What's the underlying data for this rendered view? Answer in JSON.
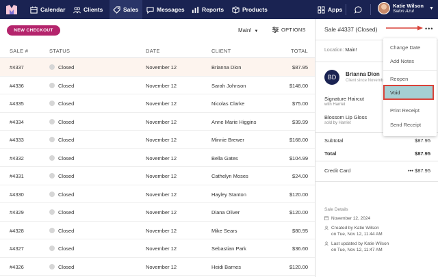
{
  "nav": {
    "items": [
      {
        "label": "Calendar",
        "icon": "calendar-icon"
      },
      {
        "label": "Clients",
        "icon": "users-icon"
      },
      {
        "label": "Sales",
        "icon": "tag-icon",
        "active": true
      },
      {
        "label": "Messages",
        "icon": "chat-icon"
      },
      {
        "label": "Reports",
        "icon": "bar-chart-icon"
      },
      {
        "label": "Products",
        "icon": "box-icon"
      }
    ],
    "apps_label": "Apps",
    "user_name": "Katie Wilson",
    "user_salon": "Salon Azul",
    "brand_color": "#1a2352",
    "accent_color": "#b4246c"
  },
  "toolbar": {
    "new_checkout_label": "NEW CHECKOUT",
    "location_select": "Main!",
    "options_label": "OPTIONS"
  },
  "table": {
    "headers": [
      "SALE #",
      "STATUS",
      "DATE",
      "CLIENT",
      "TOTAL"
    ],
    "rows": [
      {
        "sale": "#4337",
        "status": "Closed",
        "date": "November 12",
        "client": "Brianna Dion",
        "total": "$87.95"
      },
      {
        "sale": "#4336",
        "status": "Closed",
        "date": "November 12",
        "client": "Sarah Johnson",
        "total": "$148.00"
      },
      {
        "sale": "#4335",
        "status": "Closed",
        "date": "November 12",
        "client": "Nicolas Clarke",
        "total": "$75.00"
      },
      {
        "sale": "#4334",
        "status": "Closed",
        "date": "November 12",
        "client": "Anne Marie Higgins",
        "total": "$39.99"
      },
      {
        "sale": "#4333",
        "status": "Closed",
        "date": "November 12",
        "client": "Minnie Brewer",
        "total": "$168.00"
      },
      {
        "sale": "#4332",
        "status": "Closed",
        "date": "November 12",
        "client": "Bella Gates",
        "total": "$104.99"
      },
      {
        "sale": "#4331",
        "status": "Closed",
        "date": "November 12",
        "client": "Cathelyn Moses",
        "total": "$24.00"
      },
      {
        "sale": "#4330",
        "status": "Closed",
        "date": "November 12",
        "client": "Hayley Stanton",
        "total": "$120.00"
      },
      {
        "sale": "#4329",
        "status": "Closed",
        "date": "November 12",
        "client": "Diana Oliver",
        "total": "$120.00"
      },
      {
        "sale": "#4328",
        "status": "Closed",
        "date": "November 12",
        "client": "Mike Sears",
        "total": "$80.95"
      },
      {
        "sale": "#4327",
        "status": "Closed",
        "date": "November 12",
        "client": "Sebastian Park",
        "total": "$36.60"
      },
      {
        "sale": "#4326",
        "status": "Closed",
        "date": "November 12",
        "client": "Heidi Barnes",
        "total": "$120.00"
      }
    ]
  },
  "panel": {
    "title": "Sale #4337 (Closed)",
    "location_label": "Location:",
    "location_value": "Main!",
    "client_initials": "BD",
    "client_name": "Brianna Dion",
    "client_since": "Client since Novemb",
    "items": [
      {
        "name": "Signature Haircut",
        "by": "with Harriet"
      },
      {
        "name": "Blossom Lip Gloss",
        "by": "sold by Harriet"
      }
    ],
    "subtotal_label": "Subtotal",
    "subtotal_value": "$87.95",
    "total_label": "Total",
    "total_value": "$87.95",
    "payment_label": "Credit Card",
    "payment_dots": "•••",
    "payment_value": "$87.95",
    "details_heading": "Sale Details",
    "details": [
      {
        "icon": "calendar-icon",
        "lines": [
          "November 12, 2024"
        ]
      },
      {
        "icon": "user-icon",
        "lines": [
          "Created by Katie Wilson",
          "on Tue, Nov 12, 11:44 AM"
        ]
      },
      {
        "icon": "user-icon",
        "lines": [
          "Last updated by Katie Wilson",
          "on Tue, Nov 12, 11:47 AM"
        ]
      }
    ]
  },
  "menu": {
    "items": [
      "Change Date",
      "Add Notes",
      "Reopen",
      "Void",
      "Print Receipt",
      "Send Receipt"
    ],
    "highlighted": "Void",
    "highlight_fill": "#a5cfd3",
    "highlight_border": "#d94238"
  }
}
